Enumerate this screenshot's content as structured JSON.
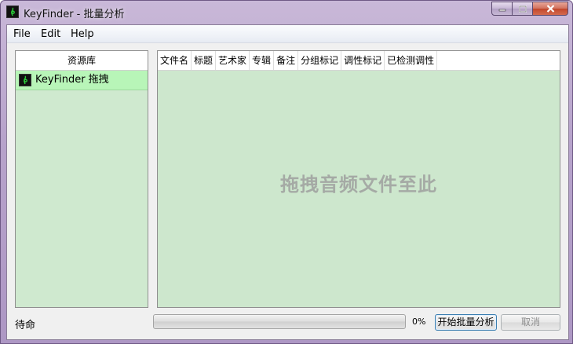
{
  "window": {
    "title": "KeyFinder - 批量分析"
  },
  "menu": {
    "items": [
      "File",
      "Edit",
      "Help"
    ]
  },
  "library": {
    "header": "资源库",
    "items": [
      {
        "label": "KeyFinder 拖拽",
        "selected": true
      }
    ]
  },
  "table": {
    "columns": [
      "文件名",
      "标题",
      "艺术家",
      "专辑",
      "备注",
      "分组标记",
      "调性标记",
      "已检测调性"
    ],
    "rows": [],
    "drop_hint": "拖拽音频文件至此"
  },
  "status": {
    "text": "待命",
    "progress_percent": 0,
    "progress_label": "0%"
  },
  "buttons": {
    "start": "开始批量分析",
    "cancel": "取消"
  },
  "colors": {
    "panel_bg": "#cde7cd",
    "selected_item": "#b8f5b8",
    "frame": "#b7a3cb",
    "progress_fill": "#06b025"
  },
  "icons": {
    "app": "treble-clef-icon",
    "minimize": "minimize-icon",
    "maximize": "maximize-icon",
    "close": "close-icon"
  }
}
